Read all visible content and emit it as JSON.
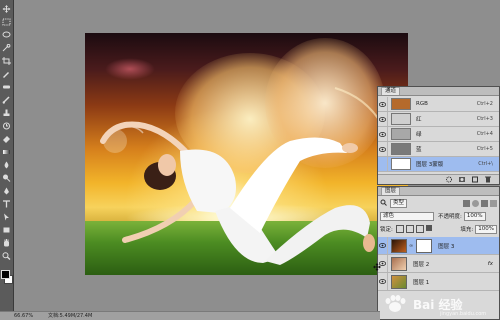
{
  "tools": [
    "move-icon",
    "marquee-icon",
    "lasso-icon",
    "quick-select-icon",
    "crop-icon",
    "eyedropper-icon",
    "spot-heal-icon",
    "brush-icon",
    "clone-stamp-icon",
    "history-brush-icon",
    "eraser-icon",
    "gradient-icon",
    "blur-icon",
    "dodge-icon",
    "pen-icon",
    "type-icon",
    "path-select-icon",
    "shape-icon",
    "hand-icon",
    "zoom-icon"
  ],
  "channels": {
    "tab_label": "通道",
    "rows": [
      {
        "name": "RGB",
        "shortcut": "Ctrl+2",
        "thumb": "#b56a2c"
      },
      {
        "name": "红",
        "shortcut": "Ctrl+3",
        "thumb": "#cfcfcf"
      },
      {
        "name": "绿",
        "shortcut": "Ctrl+4",
        "thumb": "#a8a8a8"
      },
      {
        "name": "蓝",
        "shortcut": "Ctrl+5",
        "thumb": "#7a7a7a"
      },
      {
        "name": "图层 3蒙版",
        "shortcut": "Ctrl+\\",
        "thumb": "#ffffff"
      }
    ]
  },
  "layers": {
    "tab_label": "图层",
    "filter_label": "类型",
    "blend_mode": "滤色",
    "opacity_label": "不透明度:",
    "opacity_value": "100%",
    "lock_label": "锁定:",
    "fill_label": "填充:",
    "fill_value": "100%",
    "rows": [
      {
        "name": "图层 3",
        "fx": "",
        "thumb": "#3a2010"
      },
      {
        "name": "图层 2",
        "fx": "fx",
        "thumb": "#a87050"
      },
      {
        "name": "图层 1",
        "fx": "",
        "thumb": "#d09040"
      }
    ]
  },
  "status": {
    "zoom": "66.67%",
    "doc": "文档:5.49M/27.4M"
  },
  "watermark": {
    "text": "Bai 经验",
    "sub": "jingyan.baidu.com"
  },
  "colors": {
    "accent_selected": "#9ebcef",
    "workspace": "#8e8e8e"
  }
}
